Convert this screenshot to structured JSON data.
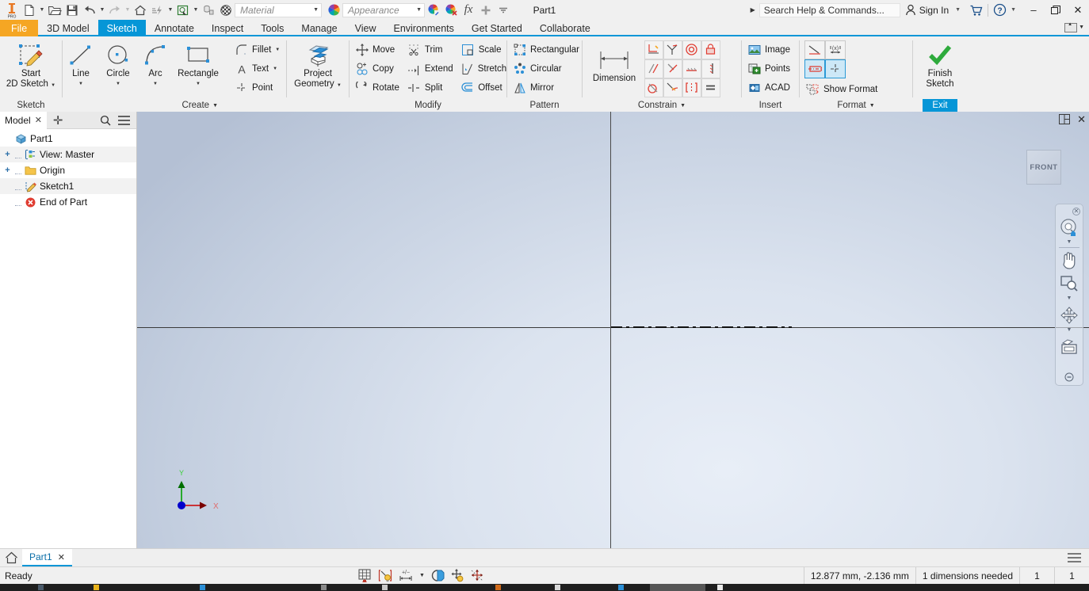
{
  "app": {
    "document_title": "Part1",
    "logo": "inventor-pro-logo"
  },
  "quick_access": {
    "items": [
      {
        "name": "new-file",
        "icon": "page-icon",
        "caret": true
      },
      {
        "name": "open-file",
        "icon": "folder-open-icon",
        "caret": false
      },
      {
        "name": "save",
        "icon": "floppy-disk-icon",
        "caret": false
      },
      {
        "name": "undo",
        "icon": "undo-arrow-icon",
        "caret": true
      },
      {
        "name": "redo",
        "icon": "redo-arrow-icon",
        "caret": true
      },
      {
        "name": "home",
        "icon": "home-icon",
        "caret": false
      },
      {
        "name": "update",
        "icon": "lightning-icon",
        "caret": true
      },
      {
        "name": "select",
        "icon": "select-box-icon",
        "caret": true
      },
      {
        "name": "appearance-override",
        "icon": "cylinder-icon",
        "caret": false
      },
      {
        "name": "material-sphere",
        "icon": "checker-sphere-icon",
        "caret": false
      }
    ],
    "material": {
      "value": "",
      "placeholder": "Material"
    },
    "appearance": {
      "value": "",
      "placeholder": "Appearance"
    },
    "extra": [
      {
        "name": "adjust-appearance",
        "icon": "color-wheel-edit-icon"
      },
      {
        "name": "clear-appearance",
        "icon": "color-wheel-clear-icon"
      },
      {
        "name": "parameters",
        "icon": "fx-icon"
      },
      {
        "name": "add-to-quick-access",
        "icon": "plus-icon"
      },
      {
        "name": "customize-quick-access",
        "icon": "caret-down-icon"
      }
    ]
  },
  "title_right": {
    "search_placeholder": "Search Help & Commands...",
    "sign_in": "Sign In",
    "cart_icon": "shopping-cart-icon",
    "help_icon": "question-mark-icon",
    "minimize": "–",
    "restore": "❐",
    "close": "✕"
  },
  "ribbon_tabs": [
    {
      "label": "File",
      "state": "file"
    },
    {
      "label": "3D Model",
      "state": "normal"
    },
    {
      "label": "Sketch",
      "state": "active"
    },
    {
      "label": "Annotate",
      "state": "normal"
    },
    {
      "label": "Inspect",
      "state": "normal"
    },
    {
      "label": "Tools",
      "state": "normal"
    },
    {
      "label": "Manage",
      "state": "normal"
    },
    {
      "label": "View",
      "state": "normal"
    },
    {
      "label": "Environments",
      "state": "normal"
    },
    {
      "label": "Get Started",
      "state": "normal"
    },
    {
      "label": "Collaborate",
      "state": "normal"
    }
  ],
  "ribbon": {
    "sketch_panel": {
      "title": "Sketch",
      "start_2d_sketch": {
        "line1": "Start",
        "line2": "2D Sketch",
        "icon": "start-2d-sketch-icon"
      }
    },
    "create_panel": {
      "title": "Create",
      "big": [
        {
          "label": "Line",
          "icon": "line-icon",
          "caret": true
        },
        {
          "label": "Circle",
          "icon": "circle-icon",
          "caret": true
        },
        {
          "label": "Arc",
          "icon": "arc-icon",
          "caret": true
        },
        {
          "label": "Rectangle",
          "icon": "rectangle-icon",
          "caret": true
        }
      ],
      "small": [
        {
          "label": "Fillet",
          "icon": "fillet-icon",
          "caret": true
        },
        {
          "label": "Text",
          "icon": "text-a-icon",
          "caret": true
        },
        {
          "label": "Point",
          "icon": "point-icon",
          "caret": false
        }
      ],
      "project_geometry": {
        "line1": "Project",
        "line2": "Geometry",
        "icon": "project-geometry-icon"
      }
    },
    "modify_panel": {
      "title": "Modify",
      "items": [
        {
          "label": "Move",
          "icon": "move-icon"
        },
        {
          "label": "Trim",
          "icon": "trim-icon"
        },
        {
          "label": "Scale",
          "icon": "scale-icon"
        },
        {
          "label": "Copy",
          "icon": "copy-icon"
        },
        {
          "label": "Extend",
          "icon": "extend-icon"
        },
        {
          "label": "Stretch",
          "icon": "stretch-icon"
        },
        {
          "label": "Rotate",
          "icon": "rotate-icon"
        },
        {
          "label": "Split",
          "icon": "split-icon"
        },
        {
          "label": "Offset",
          "icon": "offset-icon"
        }
      ]
    },
    "pattern_panel": {
      "title": "Pattern",
      "items": [
        {
          "label": "Rectangular",
          "icon": "rectangular-pattern-icon"
        },
        {
          "label": "Circular",
          "icon": "circular-pattern-icon"
        },
        {
          "label": "Mirror",
          "icon": "mirror-icon"
        }
      ]
    },
    "constrain_panel": {
      "title": "Constrain",
      "dimension": {
        "label": "Dimension",
        "icon": "dimension-icon"
      },
      "grid": [
        {
          "name": "auto-dimension-icon"
        },
        {
          "name": "show-constraints-icon"
        },
        {
          "name": "constraint-settings-icon"
        },
        {
          "name": "perpendicular-constraint-icon"
        },
        {
          "name": "tangent-constraint-icon"
        },
        {
          "name": "concentric-constraint-icon"
        },
        {
          "name": "fix-constraint-icon"
        },
        {
          "name": "parallel-constraint-icon"
        },
        {
          "name": "coincident-constraint-icon"
        },
        {
          "name": "horizontal-constraint-icon"
        },
        {
          "name": "vertical-constraint-icon"
        },
        {
          "name": "smooth-constraint-icon"
        },
        {
          "name": "collinear-constraint-icon"
        },
        {
          "name": "symmetric-constraint-icon"
        },
        {
          "name": "equal-constraint-icon"
        }
      ]
    },
    "insert_panel": {
      "title": "Insert",
      "items": [
        {
          "label": "Image",
          "icon": "image-icon"
        },
        {
          "label": "Points",
          "icon": "points-import-icon"
        },
        {
          "label": "ACAD",
          "icon": "acad-icon"
        }
      ]
    },
    "format_panel": {
      "title": "Format",
      "grid": [
        {
          "name": "construction-line-icon",
          "selected": false
        },
        {
          "name": "driven-dimension-icon",
          "selected": false
        },
        {
          "name": "centerline-icon",
          "selected": true
        },
        {
          "name": "center-point-icon",
          "selected": true
        }
      ],
      "show_format": {
        "label": "Show Format",
        "icon": "show-format-icon"
      }
    },
    "exit_panel": {
      "finish": {
        "line1": "Finish",
        "line2": "Sketch",
        "icon": "green-check-icon"
      },
      "exit_label": "Exit"
    }
  },
  "browser": {
    "tab_label": "Model",
    "close_icon": "close-icon",
    "add_icon": "plus-icon",
    "search_icon": "search-icon",
    "menu_icon": "hamburger-menu-icon",
    "tree": [
      {
        "label": "Part1",
        "icon": "part-cube-icon",
        "expander": "",
        "indent": 0
      },
      {
        "label": "View: Master",
        "icon": "view-master-icon",
        "expander": "+",
        "indent": 1
      },
      {
        "label": "Origin",
        "icon": "folder-icon",
        "expander": "+",
        "indent": 1
      },
      {
        "label": "Sketch1",
        "icon": "sketch-icon",
        "expander": "",
        "indent": 1
      },
      {
        "label": "End of Part",
        "icon": "end-of-part-icon",
        "expander": "",
        "indent": 1
      }
    ]
  },
  "viewport": {
    "panel_split_icon": "split-view-icon",
    "close_icon": "close-icon",
    "viewcube_label": "FRONT",
    "navbar": [
      {
        "name": "navbar-close-icon"
      },
      {
        "name": "steering-wheel-home-icon"
      },
      {
        "name": "pan-hand-icon"
      },
      {
        "name": "zoom-window-icon"
      },
      {
        "name": "orbit-icon"
      },
      {
        "name": "look-at-icon"
      },
      {
        "name": "navbar-options-icon"
      }
    ],
    "axis_x_label": "X",
    "axis_y_label": "Y"
  },
  "doc_tabs": {
    "home_icon": "home-icon",
    "tabs": [
      {
        "label": "Part1",
        "close": "✕",
        "active": true
      }
    ],
    "menu_icon": "hamburger-menu-icon"
  },
  "status_bar": {
    "message": "Ready",
    "icons": [
      {
        "name": "grid-display-icon"
      },
      {
        "name": "constraint-visibility-icon"
      },
      {
        "name": "dimension-visibility-icon",
        "caret": true
      },
      {
        "name": "slice-graphics-icon"
      },
      {
        "name": "snap-to-grid-icon"
      },
      {
        "name": "degrees-of-freedom-icon"
      }
    ],
    "coordinates": "12.877 mm, -2.136 mm",
    "dimensions_needed": "1 dimensions needed",
    "value_1": "1",
    "value_2": "1"
  },
  "colors": {
    "accent_blue": "#0696d7",
    "file_orange": "#f5a623",
    "canvas_top": "#c3cedf",
    "canvas_light": "#e8eef7",
    "axis": "#3a3a3a",
    "x_axis_red": "#cc0000",
    "y_axis_green": "#00a000",
    "origin_blue": "#0000cc"
  }
}
